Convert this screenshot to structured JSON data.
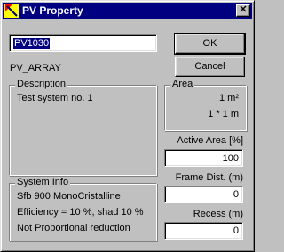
{
  "window": {
    "title": "PV Property",
    "close_glyph": "✕",
    "accent": "#000080",
    "face": "#c0c0c0"
  },
  "name_field": {
    "value": "PV1030"
  },
  "type_label": "PV_ARRAY",
  "buttons": {
    "ok": "OK",
    "cancel": "Cancel"
  },
  "description": {
    "caption": "Description",
    "text": "Test system no. 1"
  },
  "area": {
    "caption": "Area",
    "value": "1 m²",
    "dimensions": "1 *   1 m"
  },
  "active_area": {
    "label": "Active Area [%]",
    "value": "100"
  },
  "frame_dist": {
    "label": "Frame Dist. (m)",
    "value": "0"
  },
  "recess": {
    "label": "Recess (m)",
    "value": "0"
  },
  "system_info": {
    "caption": "System Info",
    "lines": [
      "Sfb 900 MonoCristalline",
      "Efficiency = 10 %, shad 10 %",
      "Not Proportional reduction"
    ]
  }
}
